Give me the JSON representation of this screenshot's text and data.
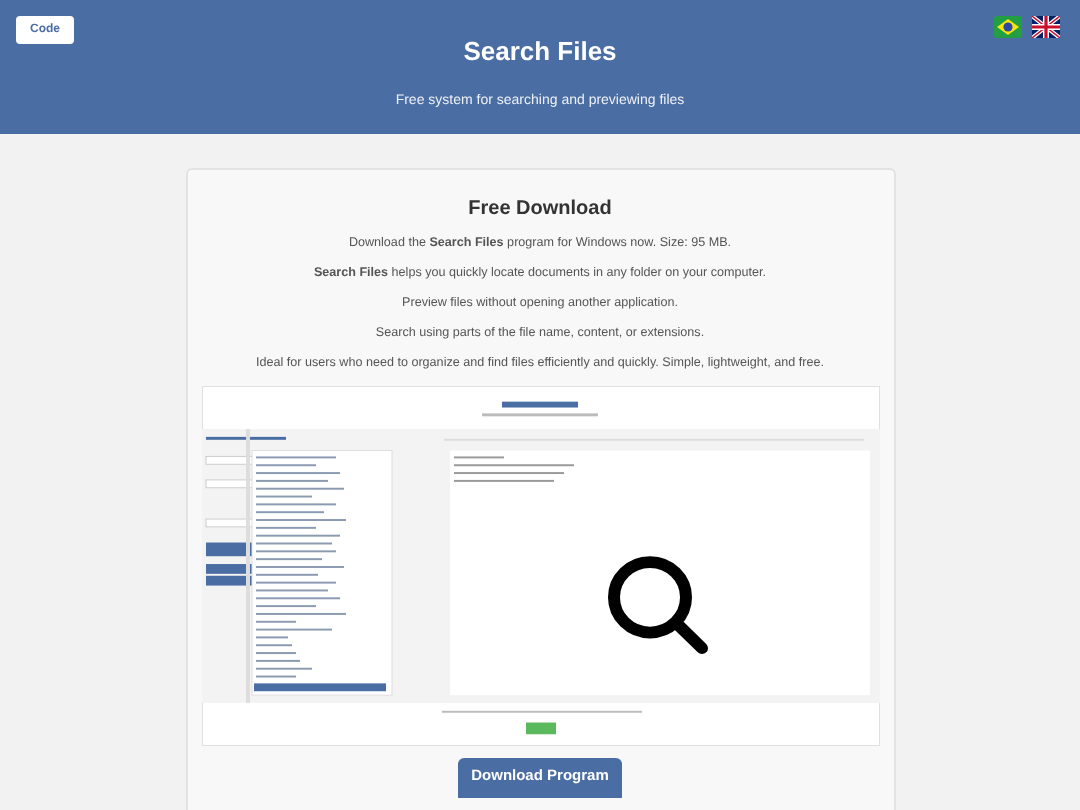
{
  "header": {
    "code_button": "Code",
    "title": "Search Files",
    "subtitle": "Free system for searching and previewing files"
  },
  "language_flags": [
    {
      "kind": "brazil"
    },
    {
      "kind": "uk"
    }
  ],
  "card": {
    "title": "Free Download",
    "paragraphs": [
      "Download the **Search Files** program for Windows now. Size: 95 MB.",
      "**Search Files** helps you quickly locate documents in any folder on your computer.",
      "Preview files without opening another application.",
      "Search using parts of the file name, content, or extensions.",
      "Ideal for users who need to organize and find files efficiently and quickly. Simple, lightweight, and free."
    ],
    "download_button": "Download Program"
  }
}
